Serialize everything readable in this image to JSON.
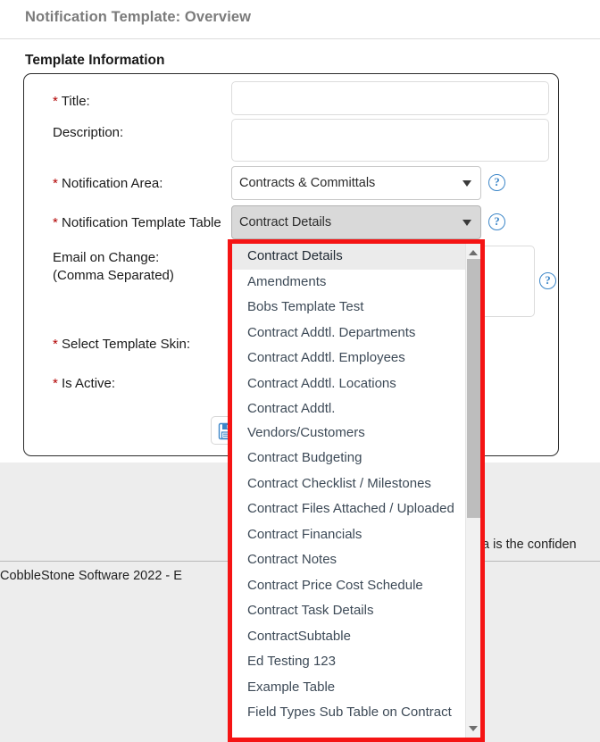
{
  "header": {
    "title": "Notification Template: Overview"
  },
  "section": {
    "heading": "Template Information"
  },
  "form": {
    "fields": {
      "title": {
        "label": "Title:",
        "required_marker": "*",
        "value": "",
        "placeholder": ""
      },
      "description": {
        "label": "Description:",
        "required_marker": "",
        "value": "",
        "placeholder": ""
      },
      "notification_area": {
        "label": "Notification Area:",
        "required_marker": "*",
        "value": "Contracts & Committals",
        "help": "?"
      },
      "notification_template_table": {
        "label": "Notification Template Table",
        "required_marker": "*",
        "value": "Contract Details",
        "help": "?"
      },
      "email_on_change": {
        "label_line1": "Email on Change:",
        "label_line2": "(Comma Separated)",
        "required_marker": "",
        "value": "",
        "help": "?"
      },
      "select_template_skin": {
        "label": "Select Template Skin:",
        "required_marker": "*"
      },
      "is_active": {
        "label": "Is Active:",
        "required_marker": "*"
      }
    },
    "save_button": {
      "icon": "save-floppy-icon",
      "label": ""
    }
  },
  "dropdown": {
    "open": true,
    "highlight_color": "#f51414",
    "selected_index": 0,
    "scroll": {
      "up_arrow": "▲",
      "down_arrow": "▼"
    },
    "options": [
      "Contract Details",
      "Amendments",
      "Bobs Template Test",
      "Contract Addtl. Departments",
      "Contract Addtl. Employees",
      "Contract Addtl. Locations",
      "Contract Addtl. Vendors/Customers",
      "Contract Budgeting",
      "Contract Checklist / Milestones",
      "Contract Files Attached / Uploaded",
      "Contract Financials",
      "Contract Notes",
      "Contract Price Cost Schedule",
      "Contract Task Details",
      "ContractSubtable",
      "Ed Testing 123",
      "Example Table",
      "Field Types Sub Table on Contract"
    ]
  },
  "footer": {
    "confidential_text": "a is the confiden",
    "copyright_text": "CobbleStone Software 2022 - E"
  }
}
